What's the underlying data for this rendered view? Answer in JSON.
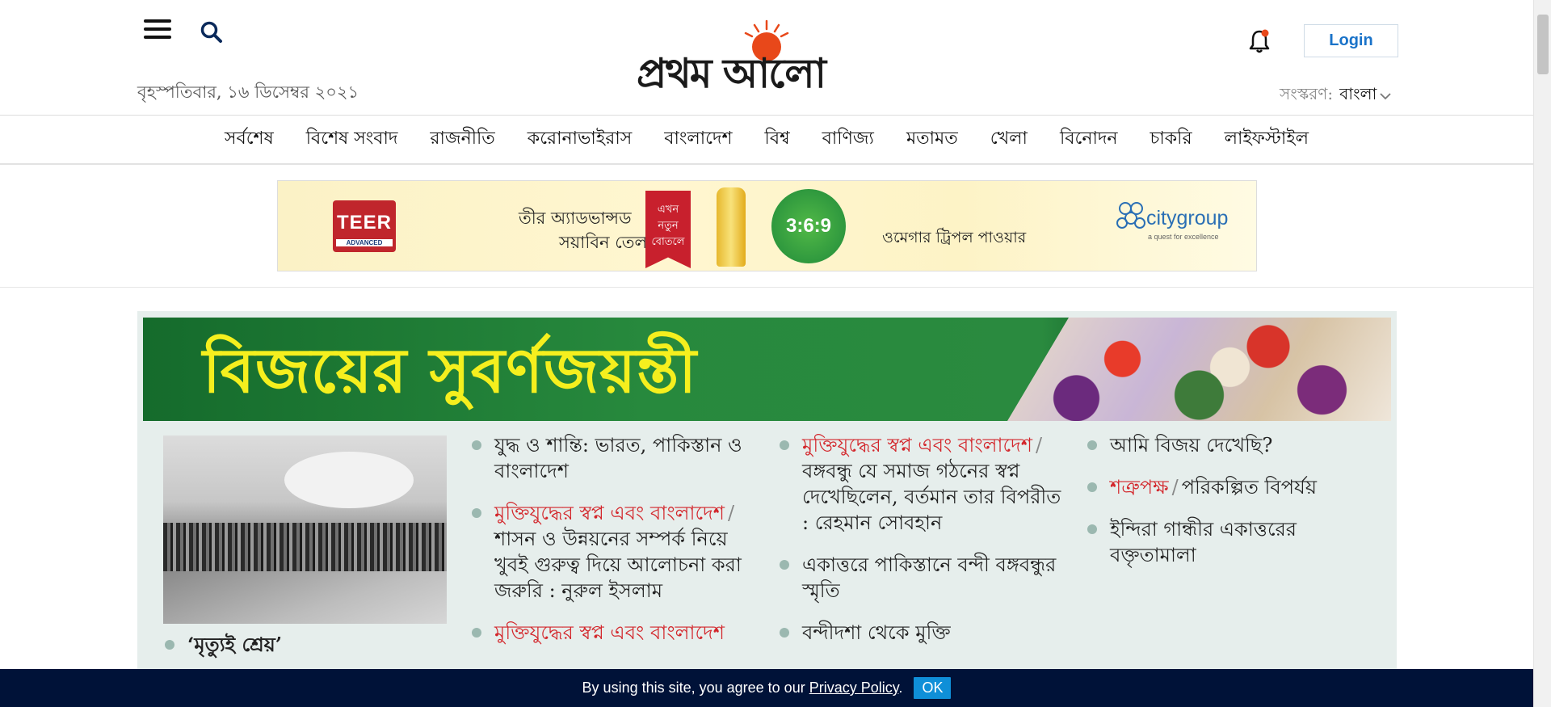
{
  "header": {
    "date": "বৃহস্পতিবার, ১৬ ডিসেম্বর ২০২১",
    "logo_text": "প্রথম আলো",
    "login_label": "Login",
    "edition_label": "সংস্করণ:",
    "edition_value": "বাংলা",
    "accent_color": "#e8481a"
  },
  "nav": {
    "items": [
      "সর্বশেষ",
      "বিশেষ সংবাদ",
      "রাজনীতি",
      "করোনাভাইরাস",
      "বাংলাদেশ",
      "বিশ্ব",
      "বাণিজ্য",
      "মতামত",
      "খেলা",
      "বিনোদন",
      "চাকরি",
      "লাইফস্টাইল"
    ]
  },
  "ad": {
    "brand": "TEER",
    "brand_sub": "ADVANCED",
    "line1": "তীর অ্যাডভান্সড",
    "line2": "সয়াবিন তেল",
    "ribbon": [
      "এখন",
      "নতুন",
      "বোতলে"
    ],
    "badge": "3:6:9",
    "tagline": "ওমেগার ট্রিপল পাওয়ার",
    "partner": "citygroup",
    "partner_tag": "a quest for excellence"
  },
  "feature": {
    "banner_title": "বিজয়ের সুবর্ণজয়ন্তী",
    "photo_caption": "‘মৃত্যুই শ্রেয়’",
    "col2": [
      {
        "title": "যুদ্ধ ও শান্তি: ভারত, পাকিস্তান ও বাংলাদেশ"
      },
      {
        "tag": "মুক্তিযুদ্ধের স্বপ্ন এবং বাংলাদেশ",
        "title": "শাসন ও উন্নয়নের সম্পর্ক নিয়ে খুবই গুরুত্ব দিয়ে আলোচনা করা জরুরি : নুরুল ইসলাম"
      },
      {
        "tag": "মুক্তিযুদ্ধের স্বপ্ন এবং বাংলাদেশ"
      }
    ],
    "col3": [
      {
        "tag": "মুক্তিযুদ্ধের স্বপ্ন এবং বাংলাদেশ",
        "title": "বঙ্গবন্ধু যে সমাজ গঠনের স্বপ্ন দেখেছিলেন, বর্তমান তার বিপরীত : রেহমান সোবহান"
      },
      {
        "title": "একাত্তরে পাকিস্তানে বন্দী বঙ্গবন্ধুর স্মৃতি"
      },
      {
        "title": "বন্দীদশা থেকে মুক্তি"
      }
    ],
    "col4": [
      {
        "title": "আমি বিজয় দেখেছি?"
      },
      {
        "tag": "শত্রুপক্ষ",
        "title": "পরিকল্পিত বিপর্যয়"
      },
      {
        "title": "ইন্দিরা গান্ধীর একাত্তরের বক্তৃতামালা"
      }
    ],
    "tag_color": "#d3262b",
    "title_color": "#f5ef1e"
  },
  "cookie": {
    "text": "By using this site, you agree to our",
    "link": "Privacy Policy",
    "period": ".",
    "ok": "OK"
  }
}
